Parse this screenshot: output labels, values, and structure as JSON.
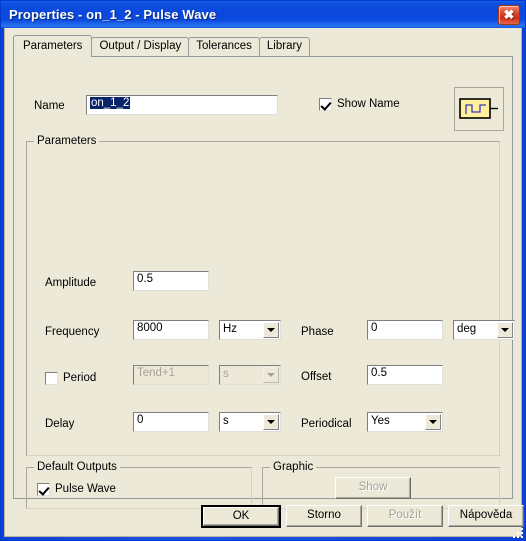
{
  "window": {
    "title": "Properties - on_1_2 - Pulse Wave",
    "close_label": "✖"
  },
  "tabs": [
    {
      "label": "Parameters",
      "active": true
    },
    {
      "label": "Output / Display",
      "active": false
    },
    {
      "label": "Tolerances",
      "active": false
    },
    {
      "label": "Library",
      "active": false
    }
  ],
  "name_row": {
    "label": "Name",
    "value": "on_1_2",
    "show_name_label": "Show Name",
    "show_name_checked": true
  },
  "parameters_group": {
    "title": "Parameters",
    "amplitude": {
      "label": "Amplitude",
      "value": "0.5"
    },
    "frequency": {
      "label": "Frequency",
      "value": "8000",
      "unit": "Hz"
    },
    "period": {
      "label": "Period",
      "checked": false,
      "value": "Tend+1",
      "unit": "s",
      "disabled": true
    },
    "delay": {
      "label": "Delay",
      "value": "0",
      "unit": "s"
    },
    "phase": {
      "label": "Phase",
      "value": "0",
      "unit": "deg"
    },
    "offset": {
      "label": "Offset",
      "value": "0.5"
    },
    "periodical": {
      "label": "Periodical",
      "value": "Yes"
    }
  },
  "default_outputs": {
    "title": "Default Outputs",
    "item_label": "Pulse Wave",
    "item_checked": true
  },
  "graphic": {
    "title": "Graphic",
    "show_label": "Show",
    "show_disabled": true
  },
  "footer_buttons": {
    "ok": "OK",
    "cancel": "Storno",
    "apply": "Použít",
    "help": "Nápověda"
  },
  "colors": {
    "titlebar_blue": "#0b47dd",
    "face": "#ece9d8",
    "selection_blue": "#0a246a",
    "icon_yellow": "#ffef9e"
  }
}
